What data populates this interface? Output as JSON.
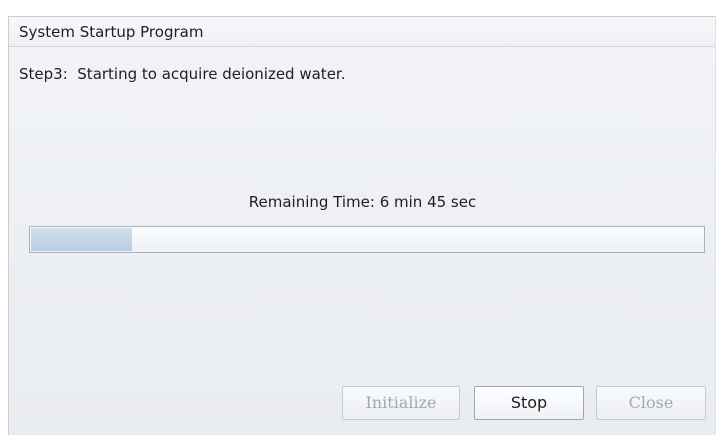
{
  "window": {
    "title": "System Startup Program"
  },
  "status": {
    "step_text": "Step3:  Starting to acquire deionized water.",
    "remaining_time": "Remaining Time: 6 min 45 sec"
  },
  "progress": {
    "fraction": 0.15
  },
  "buttons": {
    "initialize": {
      "label": "Initialize",
      "enabled": false
    },
    "stop": {
      "label": "Stop",
      "enabled": true
    },
    "close": {
      "label": "Close",
      "enabled": false
    }
  },
  "colors": {
    "progress_fill": "#c3d5e6",
    "disabled_text": "#a4a8ad",
    "panel_background": "#eceff2"
  }
}
